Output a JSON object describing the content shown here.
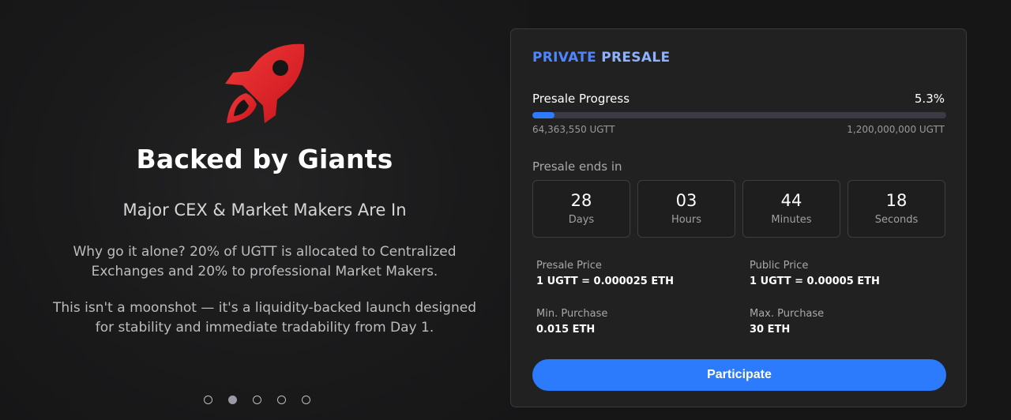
{
  "hero": {
    "title": "Backed by Giants",
    "subtitle": "Major CEX & Market Makers Are In",
    "paragraph1": "Why go it alone? 20% of UGTT is allocated to Centralized Exchanges and 20% to professional Market Makers.",
    "paragraph2": "This isn't a moonshot — it's a liquidity-backed launch designed for stability and immediate tradability from Day 1.",
    "icon": "rocket-icon",
    "slides_total": 5,
    "active_slide": 2
  },
  "presale": {
    "title_part1": "PRIVATE",
    "title_part2": " PRESALE",
    "progress_label": "Presale Progress",
    "progress_percent_text": "5.3%",
    "progress_fraction": 0.053,
    "raised": "64,363,550 UGTT",
    "goal": "1,200,000,000 UGTT",
    "ends_label": "Presale ends in",
    "countdown": [
      {
        "value": "28",
        "unit": "Days"
      },
      {
        "value": "03",
        "unit": "Hours"
      },
      {
        "value": "44",
        "unit": "Minutes"
      },
      {
        "value": "18",
        "unit": "Seconds"
      }
    ],
    "presale_price_label": "Presale Price",
    "presale_price": "1 UGTT = 0.000025 ETH",
    "public_price_label": "Public Price",
    "public_price": "1 UGTT = 0.00005 ETH",
    "min_label": "Min. Purchase",
    "min_value": "0.015 ETH",
    "max_label": "Max. Purchase",
    "max_value": "30 ETH",
    "button_label": "Participate"
  },
  "colors": {
    "accent": "#2b7bfc",
    "rocket": "#e8232b",
    "background": "#161617",
    "card": "#212122"
  }
}
